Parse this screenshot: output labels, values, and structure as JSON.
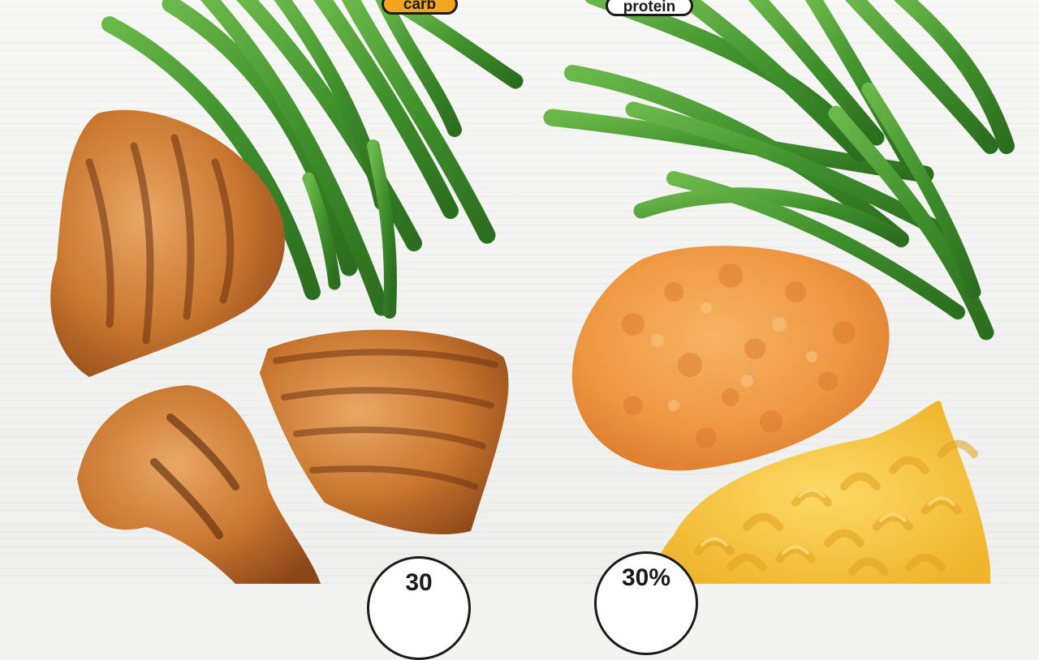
{
  "labels": {
    "left_tag": "carb",
    "right_tag": "protein",
    "left_badge": "30",
    "right_badge": "30%"
  },
  "colors": {
    "background": "#f3f3f1",
    "green_bean": "#3f8f2c",
    "grilled_chicken": "#c9772f",
    "fried_chicken": "#ee9640",
    "mac_and_cheese": "#f6c83f",
    "tag_orange": "#f2a51f"
  },
  "scene": {
    "items": [
      "green-beans-left",
      "green-beans-right",
      "grilled-chicken-breast",
      "grilled-chicken-thigh",
      "grilled-chicken-drumstick",
      "fried-chicken",
      "mac-and-cheese"
    ]
  }
}
